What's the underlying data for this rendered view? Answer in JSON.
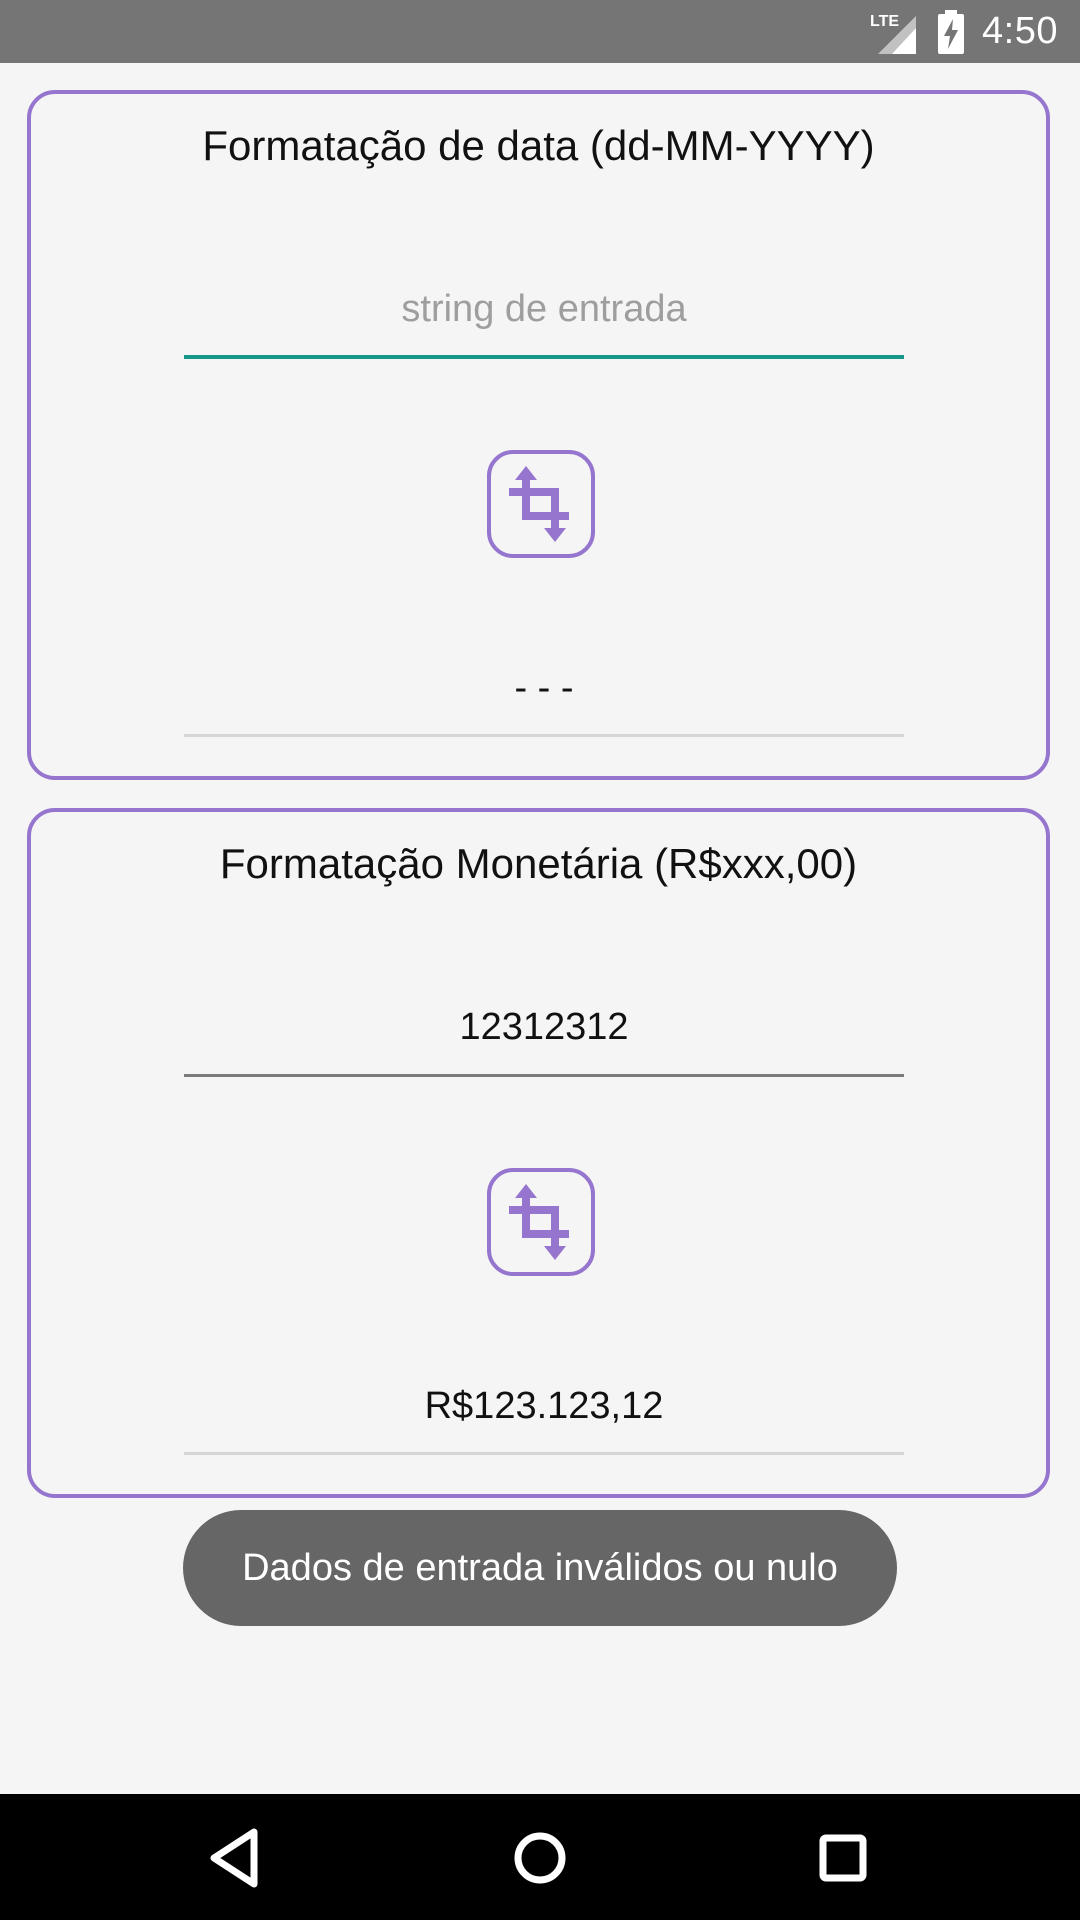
{
  "status_bar": {
    "network": "LTE",
    "time": "4:50"
  },
  "date_card": {
    "title": "Formatação de data (dd-MM-YYYY)",
    "input_placeholder": "string de entrada",
    "input_value": "",
    "output_value": "- - -"
  },
  "money_card": {
    "title": "Formatação Monetária (R$xxx,00)",
    "input_value": "12312312",
    "output_value": "R$123.123,12"
  },
  "toast": {
    "message": "Dados de entrada inválidos ou nulo"
  },
  "colors": {
    "accent": "#9575cd",
    "focus_underline": "#159688",
    "status_bar": "#757575",
    "toast_bg": "#666666"
  },
  "icons": [
    "lte-signal-icon",
    "battery-charging-icon",
    "transform-icon",
    "back-icon",
    "home-icon",
    "recents-icon"
  ]
}
